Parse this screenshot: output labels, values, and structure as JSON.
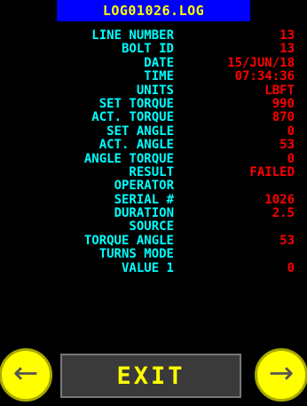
{
  "title": "LOG01026.LOG",
  "rows": [
    {
      "label": "LINE NUMBER",
      "value": "13"
    },
    {
      "label": "BOLT ID",
      "value": "13"
    },
    {
      "label": "DATE",
      "value": "15/JUN/18"
    },
    {
      "label": "TIME",
      "value": "07:34:36"
    },
    {
      "label": "UNITS",
      "value": "LBFT"
    },
    {
      "label": "SET TORQUE",
      "value": "990"
    },
    {
      "label": "ACT. TORQUE",
      "value": "870"
    },
    {
      "label": "SET ANGLE",
      "value": "0"
    },
    {
      "label": "ACT. ANGLE",
      "value": "53"
    },
    {
      "label": "ANGLE TORQUE",
      "value": "0"
    },
    {
      "label": "RESULT",
      "value": "FAILED"
    },
    {
      "label": "OPERATOR",
      "value": ""
    },
    {
      "label": "SERIAL #",
      "value": "1026"
    },
    {
      "label": "DURATION",
      "value": "2.5"
    },
    {
      "label": "SOURCE",
      "value": ""
    },
    {
      "label": "TORQUE ANGLE",
      "value": "53"
    },
    {
      "label": "TURNS MODE",
      "value": ""
    },
    {
      "label": "VALUE 1",
      "value": "0"
    }
  ],
  "buttons": {
    "exit_label": "EXIT",
    "prev_glyph": "←",
    "next_glyph": "→"
  },
  "colors": {
    "label": "#00ffff",
    "value": "#ff0000",
    "title_bg": "#0000ff",
    "title_fg": "#ffff00",
    "nav_button": "#ffff00",
    "exit_bg": "#3a3a3a"
  }
}
